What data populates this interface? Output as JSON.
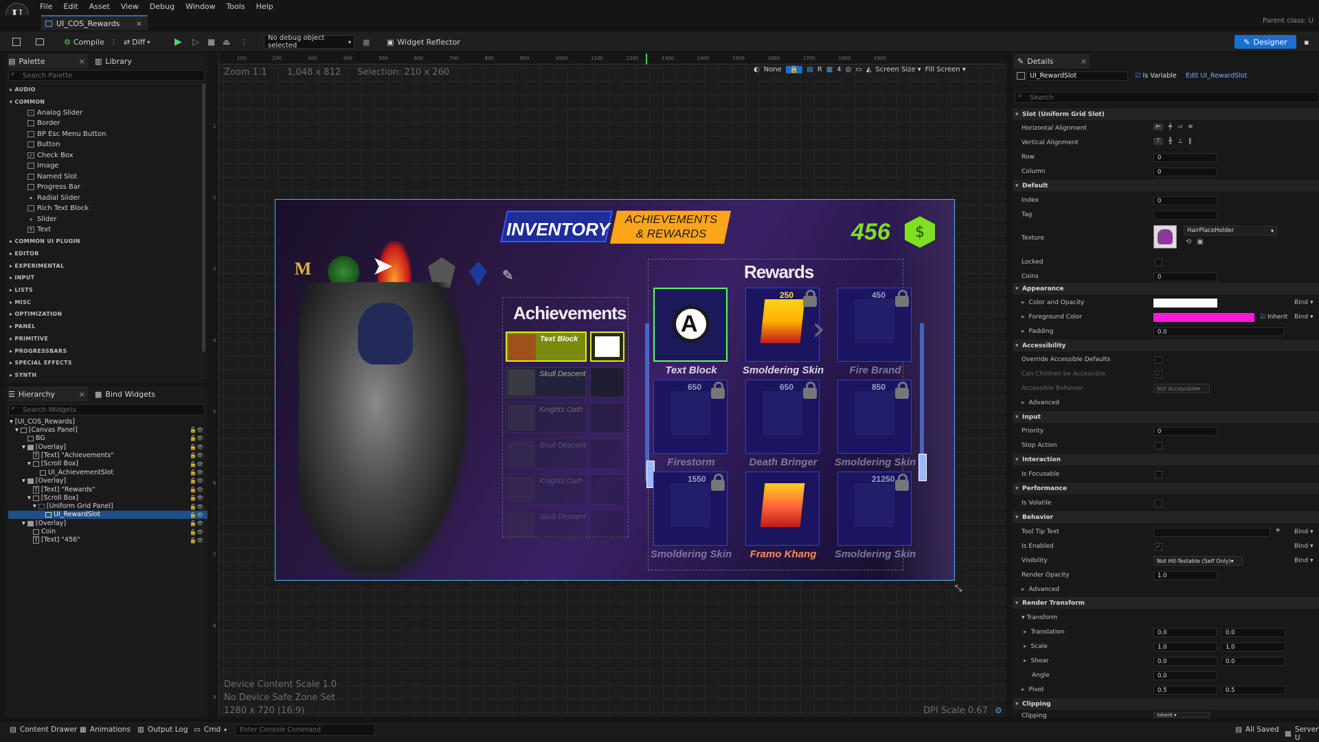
{
  "app": {
    "logo": "U",
    "parent_class": "Parent class: U"
  },
  "menu": [
    "File",
    "Edit",
    "Asset",
    "View",
    "Debug",
    "Window",
    "Tools",
    "Help"
  ],
  "doc_tab": {
    "title": "UI_COS_Rewards",
    "close": "×"
  },
  "toolbar": {
    "compile": "Compile",
    "diff": "Diff",
    "debug_object": "No debug object selected",
    "widget_reflector": "Widget Reflector",
    "designer": "Designer"
  },
  "palette": {
    "tab": "Palette",
    "library_tab": "Library",
    "search_placeholder": "Search Palette",
    "categories_top": [
      "AUDIO",
      "COMMON"
    ],
    "common_items": [
      "Analog Slider",
      "Border",
      "BP Esc Menu Button",
      "Button",
      "Check Box",
      "Image",
      "Named Slot",
      "Progress Bar",
      "Radial Slider",
      "Rich Text Block",
      "Slider",
      "Text"
    ],
    "categories_bottom": [
      "COMMON UI PLUGIN",
      "EDITOR",
      "EXPERIMENTAL",
      "INPUT",
      "LISTS",
      "MISC",
      "OPTIMIZATION",
      "PANEL",
      "PRIMITIVE",
      "PROGRESSBARS",
      "SPECIAL EFFECTS",
      "SYNTH"
    ]
  },
  "hierarchy": {
    "tab": "Hierarchy",
    "bind_tab": "Bind Widgets",
    "search_placeholder": "Search Widgets",
    "items": [
      "[UI_COS_Rewards]",
      "[Canvas Panel]",
      "BG",
      "[Overlay]",
      "[Text] \"Achievements\"",
      "[Scroll Box]",
      "UI_AchievementSlot",
      "[Overlay]",
      "[Text] \"Rewards\"",
      "[Scroll Box]",
      "[Uniform Grid Panel]",
      "UI_RewardSlot",
      "[Overlay]",
      "Coin",
      "[Text] \"456\""
    ]
  },
  "viewport": {
    "zoom": "Zoom 1:1",
    "size": "1,048 x 812",
    "selection": "Selection: 210 x 260",
    "toolbar_none": "None",
    "toolbar_r": "R",
    "grid_num": "4",
    "screen_size": "Screen Size",
    "fill_screen": "Fill Screen",
    "ruler_ticks": [
      "100",
      "200",
      "300",
      "400",
      "500",
      "600",
      "700",
      "800",
      "900",
      "1000",
      "1100",
      "1200",
      "1300",
      "1400",
      "1500",
      "1600",
      "1700",
      "1800",
      "1900"
    ],
    "vruler_ticks": [
      "1",
      "2",
      "3",
      "4",
      "5",
      "6",
      "7",
      "8",
      "9"
    ],
    "device_scale": "Device Content Scale 1.0",
    "safe_zone": "No Device Safe Zone Set",
    "resolution": "1280 x 720 (16:9)",
    "dpi": "DPI Scale 0.67"
  },
  "game": {
    "tab_inventory": "INVENTORY",
    "tab_achievements": "ACHIEVEMENTS & REWARDS",
    "coins": "456",
    "achievements_title": "Achievements",
    "rewards_title": "Rewards",
    "achievement_rows": [
      "Text Block",
      "Skull Descent",
      "Knights Oath",
      "Skull Descent",
      "Knights Oath",
      "Skull Descent"
    ],
    "reward_slots": [
      {
        "label": "Text Block",
        "price": "",
        "accent": "#ffffff"
      },
      {
        "label": "Smoldering Skin",
        "price": "250",
        "accent": "#ffb000"
      },
      {
        "label": "Fire Brand",
        "price": "450",
        "accent": "#8a8ab0"
      },
      {
        "label": "Firestorm",
        "price": "650",
        "accent": "#8a8ab0"
      },
      {
        "label": "Death Bringer",
        "price": "650",
        "accent": "#8a8ab0"
      },
      {
        "label": "Smoldering Skin",
        "price": "850",
        "accent": "#8a8ab0"
      },
      {
        "label": "Smoldering Skin",
        "price": "1550",
        "accent": "#8a8ab0"
      },
      {
        "label": "Framo Khang",
        "price": "",
        "accent": "#ff6a3a"
      },
      {
        "label": "Smoldering Skin",
        "price": "21250",
        "accent": "#8a8ab0"
      }
    ]
  },
  "details": {
    "tab": "Details",
    "widget_name": "UI_RewardSlot",
    "is_variable": "Is Variable",
    "edit_link": "Edit UI_RewardSlot",
    "search_placeholder": "Search",
    "slot_section": "Slot (Uniform Grid Slot)",
    "horizontal_alignment": "Horizontal Alignment",
    "vertical_alignment": "Vertical Alignment",
    "row": "Row",
    "row_val": "0",
    "column": "Column",
    "column_val": "0",
    "default_section": "Default",
    "index": "Index",
    "index_val": "0",
    "tag": "Tag",
    "texture": "Texture",
    "texture_val": "HairPlaceHolder",
    "locked": "Locked",
    "coins": "Coins",
    "coins_val": "0",
    "appearance_section": "Appearance",
    "color_opacity": "Color and Opacity",
    "foreground_color": "Foreground Color",
    "inherit": "Inherit",
    "bind": "Bind",
    "padding": "Padding",
    "padding_val": "0.0",
    "accessibility_section": "Accessibility",
    "override_acc": "Override Accessible Defaults",
    "children_acc": "Can Children be Accessible",
    "acc_behavior": "Accessible Behavior",
    "acc_behavior_val": "Not Accessible",
    "advanced": "Advanced",
    "input_section": "Input",
    "priority": "Priority",
    "priority_val": "0",
    "stop_action": "Stop Action",
    "interaction_section": "Interaction",
    "is_focusable": "Is Focusable",
    "performance_section": "Performance",
    "is_volatile": "Is Volatile",
    "behavior_section": "Behavior",
    "tooltip": "Tool Tip Text",
    "is_enabled": "Is Enabled",
    "visibility": "Visibility",
    "visibility_val": "Not Hit-Testable (Self Only)",
    "render_opacity": "Render Opacity",
    "render_opacity_val": "1.0",
    "advanced2": "Advanced",
    "render_transform_section": "Render Transform",
    "transform": "Transform",
    "translation": "Translation",
    "scale": "Scale",
    "shear": "Shear",
    "angle": "Angle",
    "pivot": "Pivot",
    "t0": "0.0",
    "t1": "0.0",
    "s0": "1.0",
    "s1": "1.0",
    "sh0": "0.0",
    "sh1": "0.0",
    "ang": "0.0",
    "pv0": "0.5",
    "pv1": "0.5",
    "clipping_section": "Clipping",
    "clipping": "Clipping",
    "clipping_val": "Inherit",
    "colors": {
      "white": "#ffffff",
      "magenta": "#ff1ad9"
    }
  },
  "statusbar": {
    "content_drawer": "Content Drawer",
    "animations": "Animations",
    "output_log": "Output Log",
    "cmd": "Cmd",
    "console_placeholder": "Enter Console Command",
    "all_saved": "All Saved",
    "server": "Server U"
  }
}
